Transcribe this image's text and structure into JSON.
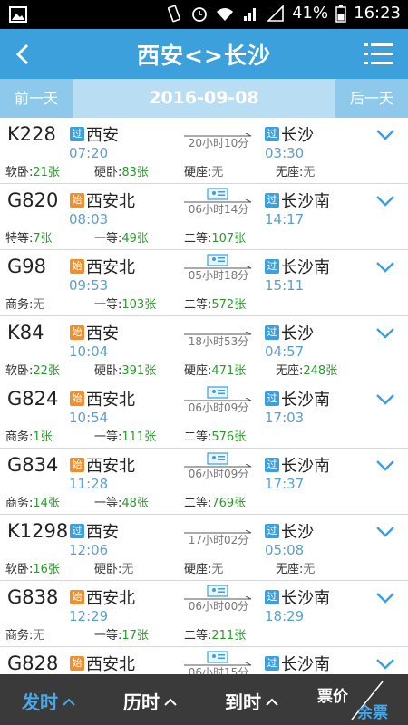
{
  "status_bar": {
    "battery": "41%",
    "time": "16:23"
  },
  "header": {
    "title": "西安<>长沙"
  },
  "date_bar": {
    "prev": "前一天",
    "date": "2016-09-08",
    "next": "后一天"
  },
  "badges": {
    "pass": "过",
    "start": "始"
  },
  "trains": [
    {
      "no": "K228",
      "from_type": "pass",
      "from": "西安",
      "dep": "07:20",
      "duration": "20小时10分",
      "to_type": "pass",
      "to": "长沙",
      "arr": "03:30",
      "ticket_icon": false,
      "seats": [
        {
          "label": "软卧:",
          "value": "21张",
          "avail": true
        },
        {
          "label": "硬卧:",
          "value": "83张",
          "avail": true
        },
        {
          "label": "硬座:",
          "value": "无",
          "avail": false
        },
        {
          "label": "无座:",
          "value": "无",
          "avail": false
        }
      ]
    },
    {
      "no": "G820",
      "from_type": "start",
      "from": "西安北",
      "dep": "08:03",
      "duration": "06小时14分",
      "to_type": "pass",
      "to": "长沙南",
      "arr": "14:17",
      "ticket_icon": true,
      "seats": [
        {
          "label": "特等:",
          "value": "7张",
          "avail": true
        },
        {
          "label": "一等:",
          "value": "49张",
          "avail": true
        },
        {
          "label": "二等:",
          "value": "107张",
          "avail": true
        }
      ]
    },
    {
      "no": "G98",
      "from_type": "start",
      "from": "西安北",
      "dep": "09:53",
      "duration": "05小时18分",
      "to_type": "pass",
      "to": "长沙南",
      "arr": "15:11",
      "ticket_icon": true,
      "seats": [
        {
          "label": "商务:",
          "value": "无",
          "avail": false
        },
        {
          "label": "一等:",
          "value": "103张",
          "avail": true
        },
        {
          "label": "二等:",
          "value": "572张",
          "avail": true
        }
      ]
    },
    {
      "no": "K84",
      "from_type": "start",
      "from": "西安",
      "dep": "10:04",
      "duration": "18小时53分",
      "to_type": "pass",
      "to": "长沙",
      "arr": "04:57",
      "ticket_icon": false,
      "seats": [
        {
          "label": "软卧:",
          "value": "22张",
          "avail": true
        },
        {
          "label": "硬卧:",
          "value": "391张",
          "avail": true
        },
        {
          "label": "硬座:",
          "value": "471张",
          "avail": true
        },
        {
          "label": "无座:",
          "value": "248张",
          "avail": true
        }
      ]
    },
    {
      "no": "G824",
      "from_type": "start",
      "from": "西安北",
      "dep": "10:54",
      "duration": "06小时09分",
      "to_type": "pass",
      "to": "长沙南",
      "arr": "17:03",
      "ticket_icon": true,
      "seats": [
        {
          "label": "商务:",
          "value": "1张",
          "avail": true
        },
        {
          "label": "一等:",
          "value": "111张",
          "avail": true
        },
        {
          "label": "二等:",
          "value": "576张",
          "avail": true
        }
      ]
    },
    {
      "no": "G834",
      "from_type": "start",
      "from": "西安北",
      "dep": "11:28",
      "duration": "06小时09分",
      "to_type": "pass",
      "to": "长沙南",
      "arr": "17:37",
      "ticket_icon": true,
      "seats": [
        {
          "label": "商务:",
          "value": "14张",
          "avail": true
        },
        {
          "label": "一等:",
          "value": "48张",
          "avail": true
        },
        {
          "label": "二等:",
          "value": "769张",
          "avail": true
        }
      ]
    },
    {
      "no": "K1298",
      "from_type": "pass",
      "from": "西安",
      "dep": "12:06",
      "duration": "17小时02分",
      "to_type": "pass",
      "to": "长沙",
      "arr": "05:08",
      "ticket_icon": false,
      "seats": [
        {
          "label": "软卧:",
          "value": "16张",
          "avail": true
        },
        {
          "label": "硬卧:",
          "value": "无",
          "avail": false
        },
        {
          "label": "硬座:",
          "value": "无",
          "avail": false
        },
        {
          "label": "无座:",
          "value": "无",
          "avail": false
        }
      ]
    },
    {
      "no": "G838",
      "from_type": "start",
      "from": "西安北",
      "dep": "12:29",
      "duration": "06小时00分",
      "to_type": "pass",
      "to": "长沙南",
      "arr": "18:29",
      "ticket_icon": true,
      "seats": [
        {
          "label": "商务:",
          "value": "无",
          "avail": false
        },
        {
          "label": "一等:",
          "value": "17张",
          "avail": true
        },
        {
          "label": "二等:",
          "value": "211张",
          "avail": true
        }
      ]
    },
    {
      "no": "G828",
      "from_type": "start",
      "from": "西安北",
      "dep": "",
      "duration": "06小时15分",
      "to_type": "pass",
      "to": "长沙南",
      "arr": "",
      "ticket_icon": true,
      "seats": []
    }
  ],
  "bottom_bar": {
    "departure": "发时",
    "history": "历时",
    "arrival": "到时",
    "price": "票价",
    "remaining": "余票"
  },
  "colors": {
    "header": "#3ba0dc",
    "pass_badge": "#3ba0dc",
    "start_badge": "#f08f2c",
    "available": "#2a9a2a",
    "time": "#5aa0cf",
    "active_tab": "#4aa8e6"
  }
}
